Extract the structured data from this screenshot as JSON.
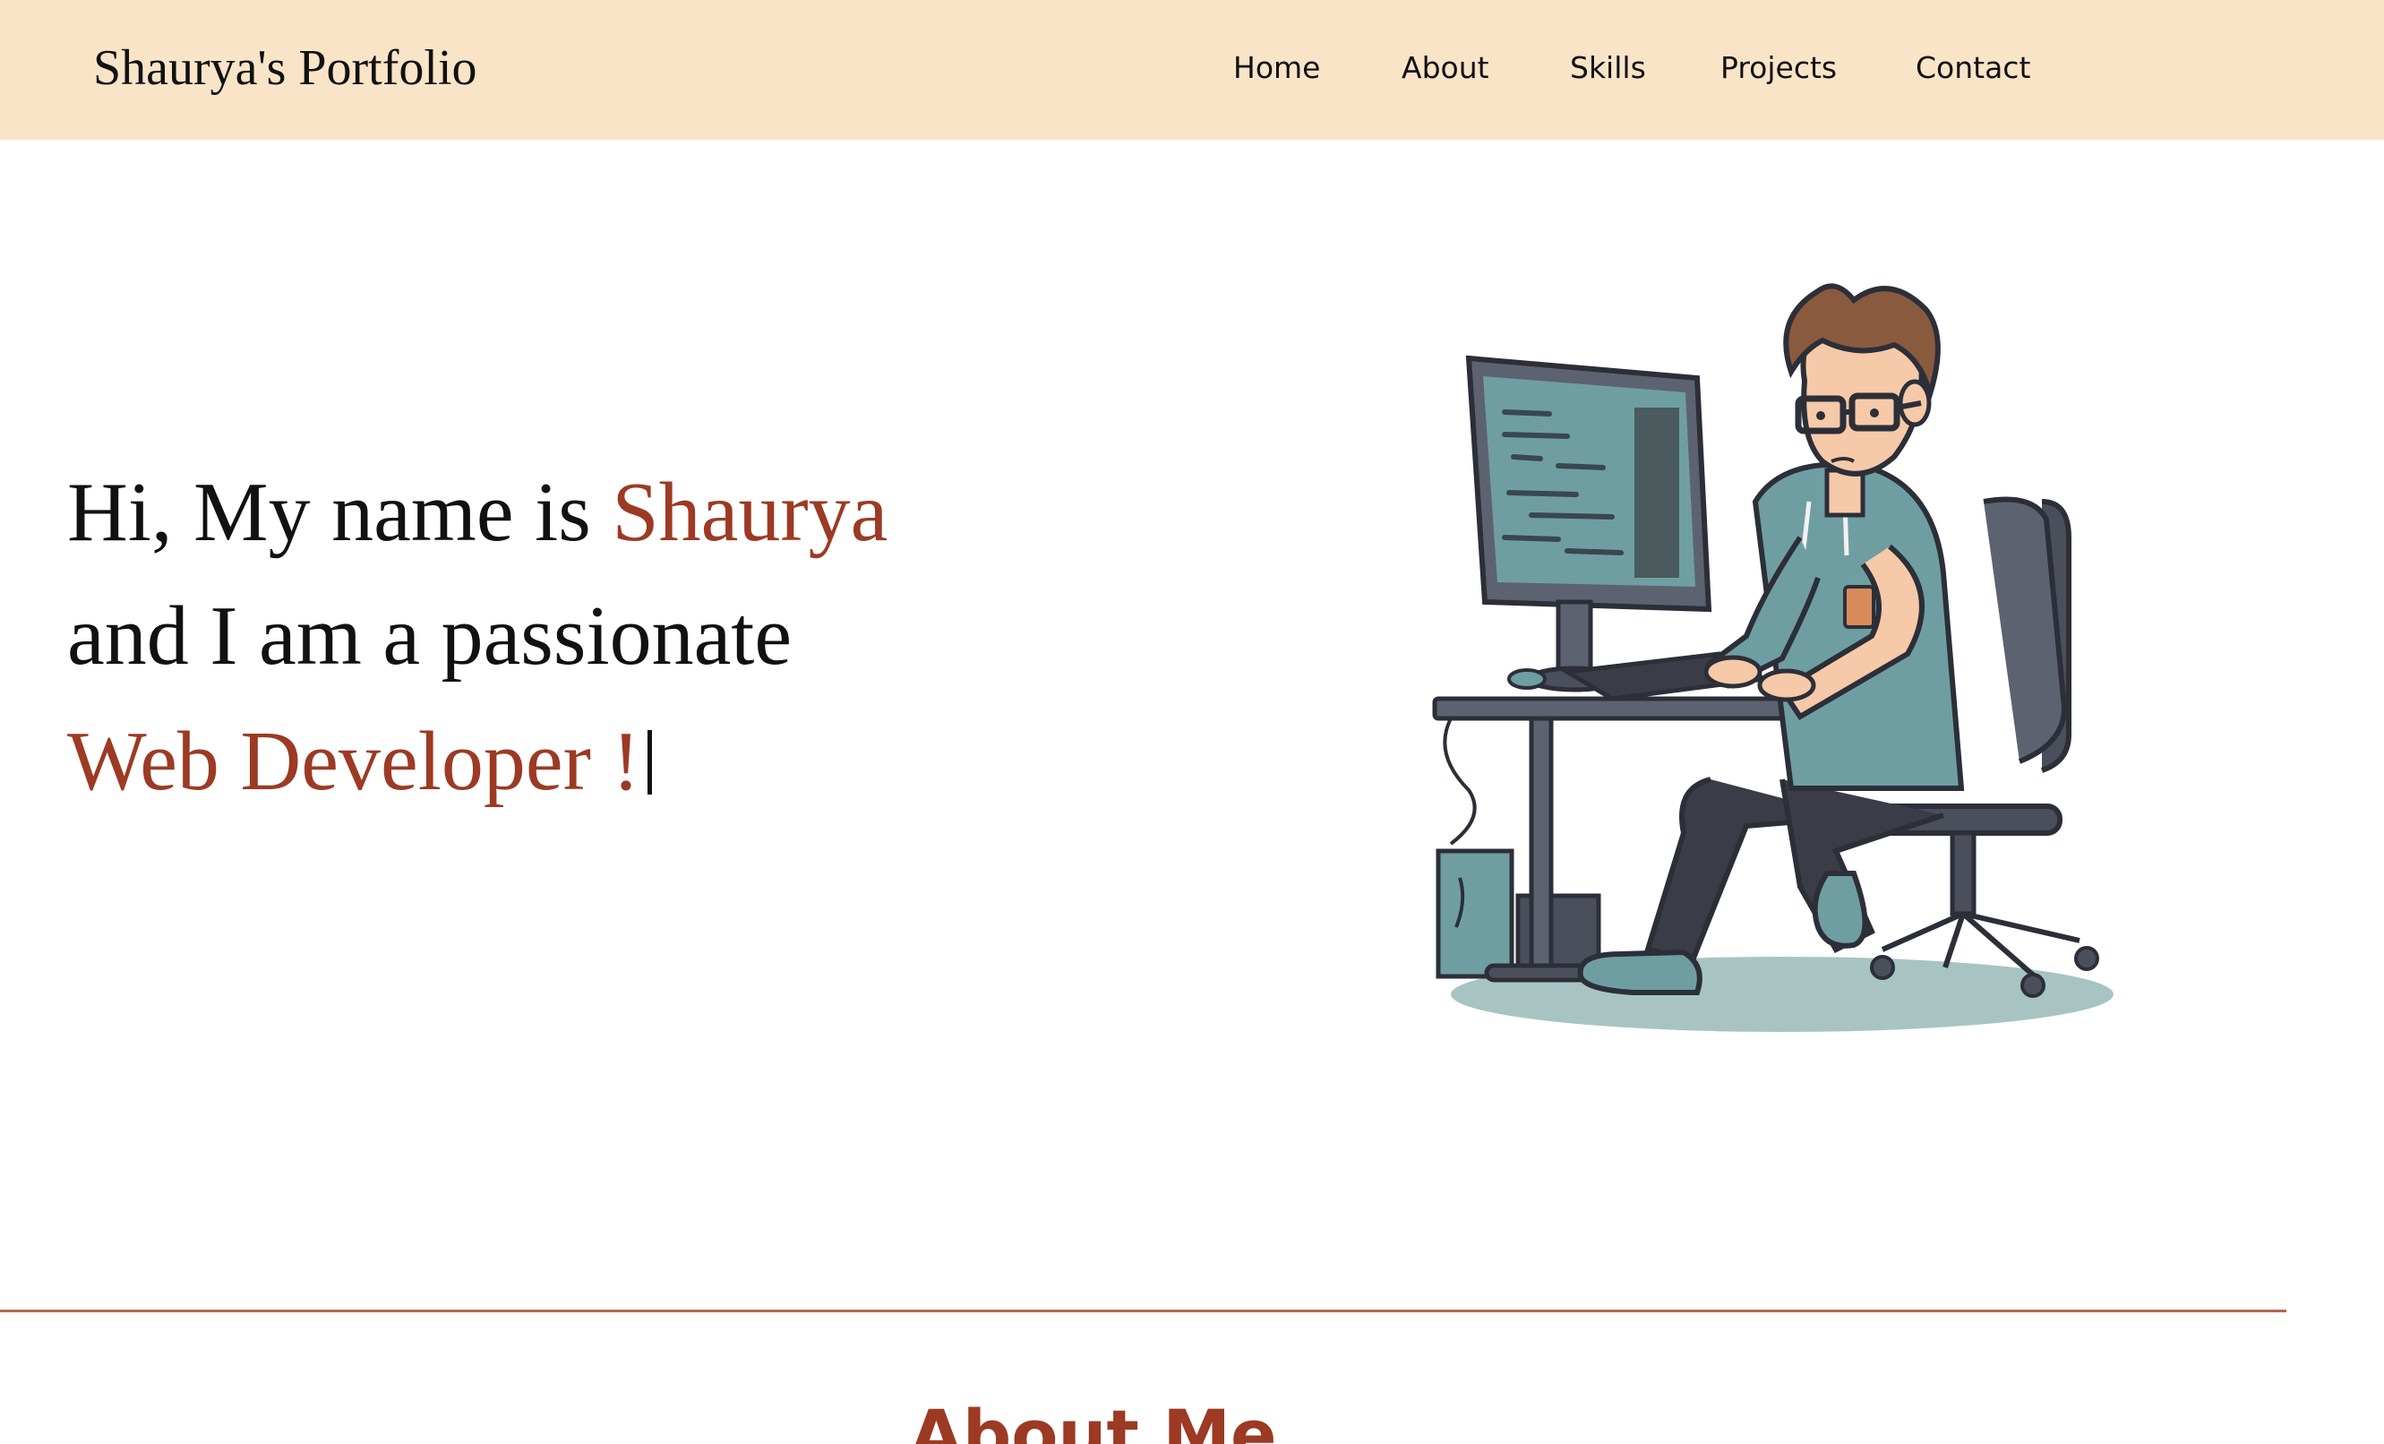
{
  "header": {
    "brand": "Shaurya's Portfolio",
    "nav": [
      {
        "label": "Home"
      },
      {
        "label": "About"
      },
      {
        "label": "Skills"
      },
      {
        "label": "Projects"
      },
      {
        "label": "Contact"
      }
    ]
  },
  "hero": {
    "line1_prefix": "Hi, My name is ",
    "name": "Shaurya",
    "line2": "and I am a passionate",
    "role": "Web Developer !",
    "illustration_icon": "developer-at-computer-illustration"
  },
  "about": {
    "title": "About Me"
  },
  "colors": {
    "header_bg": "#f9e4c8",
    "accent": "#9c3a24",
    "divider": "#b4674a"
  }
}
